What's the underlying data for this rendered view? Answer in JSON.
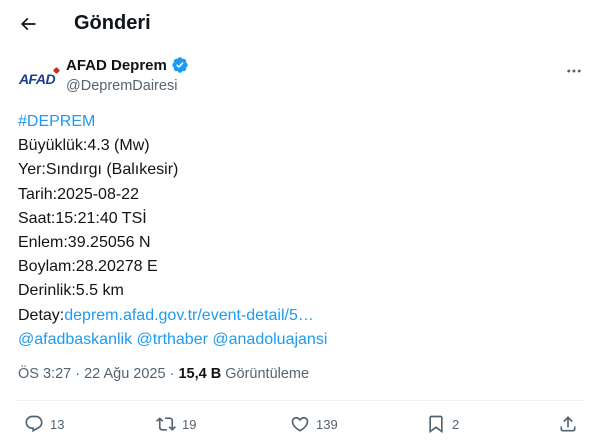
{
  "header": {
    "title": "Gönderi"
  },
  "author": {
    "logo_text": "AFAD",
    "name": "AFAD Deprem",
    "handle": "@DepremDairesi"
  },
  "tweet": {
    "hashtag": "#DEPREM",
    "lines": [
      "Büyüklük:4.3 (Mw)",
      "Yer:Sındırgı (Balıkesir)",
      "Tarih:2025-08-22",
      "Saat:15:21:40 TSİ",
      "Enlem:39.25056 N",
      "Boylam:28.20278 E",
      "Derinlik:5.5 km"
    ],
    "detail_label": "Detay:",
    "detail_link": "deprem.afad.gov.tr/event-detail/5…",
    "mentions": [
      "@afadbaskanlik",
      "@trthaber",
      "@anadoluajansi"
    ]
  },
  "meta": {
    "time": "ÖS 3:27",
    "separator": "·",
    "date": "22 Ağu 2025",
    "views": "15,4 B",
    "views_label": "Görüntüleme"
  },
  "actions": {
    "replies": "13",
    "reposts": "19",
    "likes": "139",
    "bookmarks": "2"
  },
  "colors": {
    "accent": "#1d9bf0",
    "text": "#0f1419",
    "secondary": "#536471",
    "divider": "#eff3f4"
  }
}
